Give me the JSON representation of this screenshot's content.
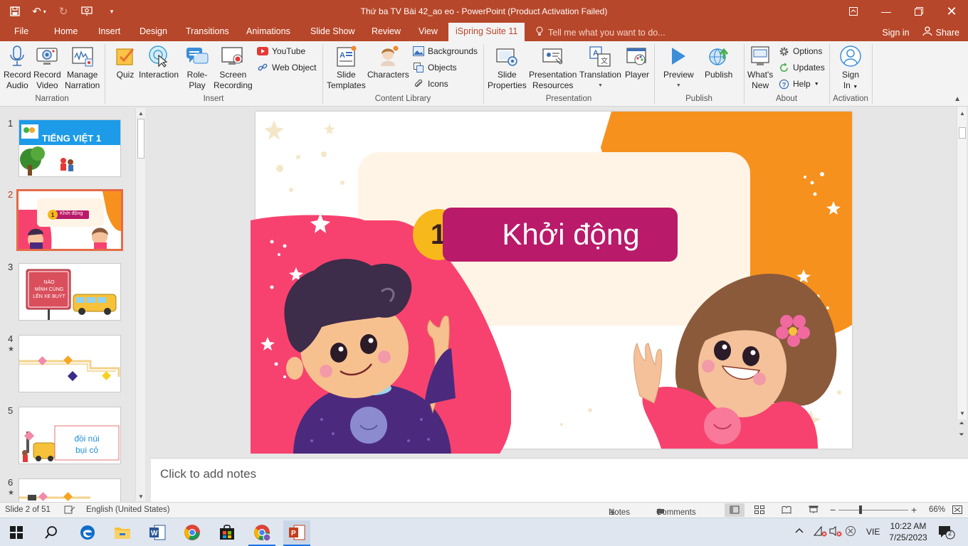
{
  "window": {
    "title": "Thứ ba TV Bài 42_ao eo - PowerPoint (Product Activation Failed)"
  },
  "tabs": [
    "File",
    "Home",
    "Insert",
    "Design",
    "Transitions",
    "Animations",
    "Slide Show",
    "Review",
    "View",
    "iSpring Suite 11"
  ],
  "active_tab": "iSpring Suite 11",
  "tell_me": "Tell me what you want to do...",
  "sign_in": "Sign in",
  "share": "Share",
  "ribbon": {
    "narration": {
      "label": "Narration",
      "record_audio": [
        "Record",
        "Audio"
      ],
      "record_video": [
        "Record",
        "Video"
      ],
      "manage_narration": [
        "Manage",
        "Narration"
      ]
    },
    "insert": {
      "label": "Insert",
      "quiz": "Quiz",
      "interaction": "Interaction",
      "roleplay": [
        "Role-",
        "Play"
      ],
      "screen_recording": [
        "Screen",
        "Recording"
      ],
      "youtube": "YouTube",
      "web_object": "Web Object"
    },
    "content_library": {
      "label": "Content Library",
      "slide_templates": [
        "Slide",
        "Templates"
      ],
      "characters": "Characters",
      "backgrounds": "Backgrounds",
      "objects": "Objects",
      "icons": "Icons"
    },
    "presentation": {
      "label": "Presentation",
      "slide_properties": [
        "Slide",
        "Properties"
      ],
      "presentation_resources": [
        "Presentation",
        "Resources"
      ],
      "translation": "Translation",
      "player": "Player"
    },
    "publish": {
      "label": "Publish",
      "preview": "Preview",
      "publish": "Publish"
    },
    "about": {
      "label": "About",
      "whats_new": [
        "What's",
        "New"
      ],
      "options": "Options",
      "updates": "Updates",
      "help": "Help"
    },
    "activation": {
      "label": "Activation",
      "sign_in": [
        "Sign",
        "In"
      ]
    }
  },
  "slides": {
    "numbers": [
      "1",
      "2",
      "3",
      "4",
      "5",
      "6"
    ],
    "t1_text": "TIẾNG VIỆT 1",
    "t2_num": "1",
    "t2_text": "Khởi động",
    "t3_sign": [
      "NÀO",
      "MÌNH CÙNG",
      "LÊN XE BUÝT"
    ],
    "t5_text": [
      "đồi núi",
      "bụi cỏ"
    ]
  },
  "main_slide": {
    "number": "1",
    "title": "Khởi động"
  },
  "notes_placeholder": "Click to add notes",
  "status": {
    "slide_info": "Slide 2 of 51",
    "language": "English (United States)",
    "notes": "Notes",
    "comments": "Comments",
    "zoom": "66%",
    "zoom_minus": "−",
    "zoom_plus": "+"
  },
  "tray": {
    "lang": "VIE",
    "time": "10:22 AM",
    "date": "7/25/2023",
    "notif_count": "2"
  },
  "colors": {
    "powerpoint_accent": "#b7472a",
    "title_pill": "#b91a6a",
    "number_circle": "#f7b81c",
    "slide_orange": "#f7911e",
    "slide_pink": "#f7426f",
    "selected_thumb_border": "#e56b46"
  }
}
